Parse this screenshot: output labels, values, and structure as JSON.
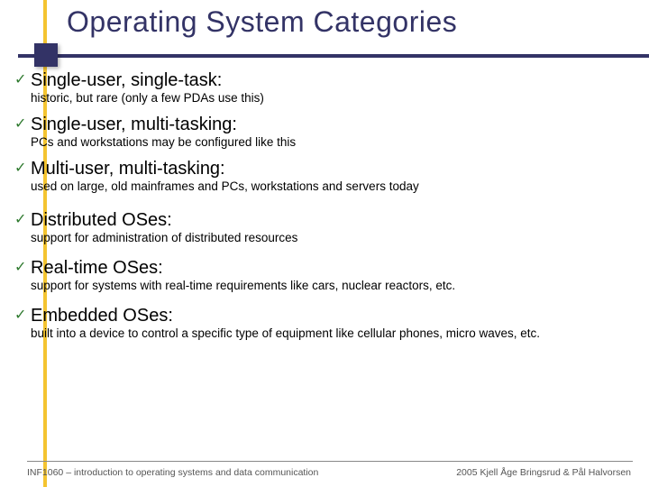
{
  "title": "Operating System Categories",
  "items": [
    {
      "label": "Single-user, single-task:",
      "desc": "historic, but rare (only a few PDAs use this)",
      "cls": ""
    },
    {
      "label": "Single-user, multi-tasking:",
      "desc": "PCs and workstations may be configured like this",
      "cls": ""
    },
    {
      "label": "Multi-user, multi-tasking:",
      "desc": "used on large, old mainframes and PCs, workstations and servers today",
      "cls": ""
    },
    {
      "label": "Distributed OSes:",
      "desc": "support for administration of distributed resources",
      "cls": "gap"
    },
    {
      "label": "Real-time OSes:",
      "desc": "support for systems with real-time requirements like cars, nuclear reactors, etc.",
      "cls": "gap2"
    },
    {
      "label": "Embedded OSes:",
      "desc": "built into a device to control a specific type of equipment like cellular phones, micro waves, etc.",
      "cls": "gap2"
    }
  ],
  "footer": {
    "left": "INF1060 – introduction to operating systems and data communication",
    "right": "2005 Kjell Åge Bringsrud & Pål Halvorsen"
  },
  "checkmark": "✓"
}
